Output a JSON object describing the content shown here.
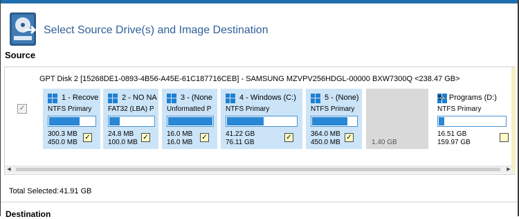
{
  "header": {
    "title": "Select Source Drive(s) and Image Destination",
    "icon": "drive-image-icon"
  },
  "source": {
    "section_label": "Source",
    "disk": {
      "label": "GPT Disk 2 [15268DE1-0893-4B56-A45E-61C187716CEB] - SAMSUNG MZVPV256HDGL-00000 BXW7300Q  <238.47 GB>",
      "selected": "✓"
    },
    "partitions": [
      {
        "name": "1 - Recove",
        "fs": "NTFS Primary",
        "used": "300.3 MB",
        "total": "450.0 MB",
        "fill_fraction": 0.67,
        "checked": "✓"
      },
      {
        "name": "2 - NO NA",
        "fs": "FAT32 (LBA) P",
        "used": "24.8 MB",
        "total": "100.0 MB",
        "fill_fraction": 0.25,
        "checked": "✓"
      },
      {
        "name": "3 - (None",
        "fs": "Unformatted P",
        "used": "16.0 MB",
        "total": "16.0 MB",
        "fill_fraction": 1.0,
        "checked": "✓"
      },
      {
        "name": "4 - Windows (C:)",
        "fs": "NTFS Primary",
        "used": "41.22 GB",
        "total": "76.11 GB",
        "fill_fraction": 0.54,
        "checked": "✓"
      },
      {
        "name": "5 - (None)",
        "fs": "NTFS Primary",
        "used": "364.0 MB",
        "total": "450.0 MB",
        "fill_fraction": 0.81,
        "checked": "✓"
      },
      {
        "name": "6 - Programs (D:)",
        "fs": "NTFS Primary",
        "used": "16.51 GB",
        "total": "159.97 GB",
        "fill_fraction": 0.1,
        "checked": ""
      }
    ],
    "unallocated": {
      "size": "1.40 GB"
    }
  },
  "summary": {
    "total_selected_label": "Total Selected:",
    "total_selected_value": "41.91 GB"
  },
  "destination": {
    "section_label": "Destination"
  },
  "colors": {
    "accent": "#1e6fb0",
    "title": "#2f5f9a",
    "partition_bg": "#cce4f7",
    "bar_fill": "#2a87d6",
    "unallocated_bg": "#d9d9d9",
    "checkbox_bg": "#fffbc4"
  }
}
